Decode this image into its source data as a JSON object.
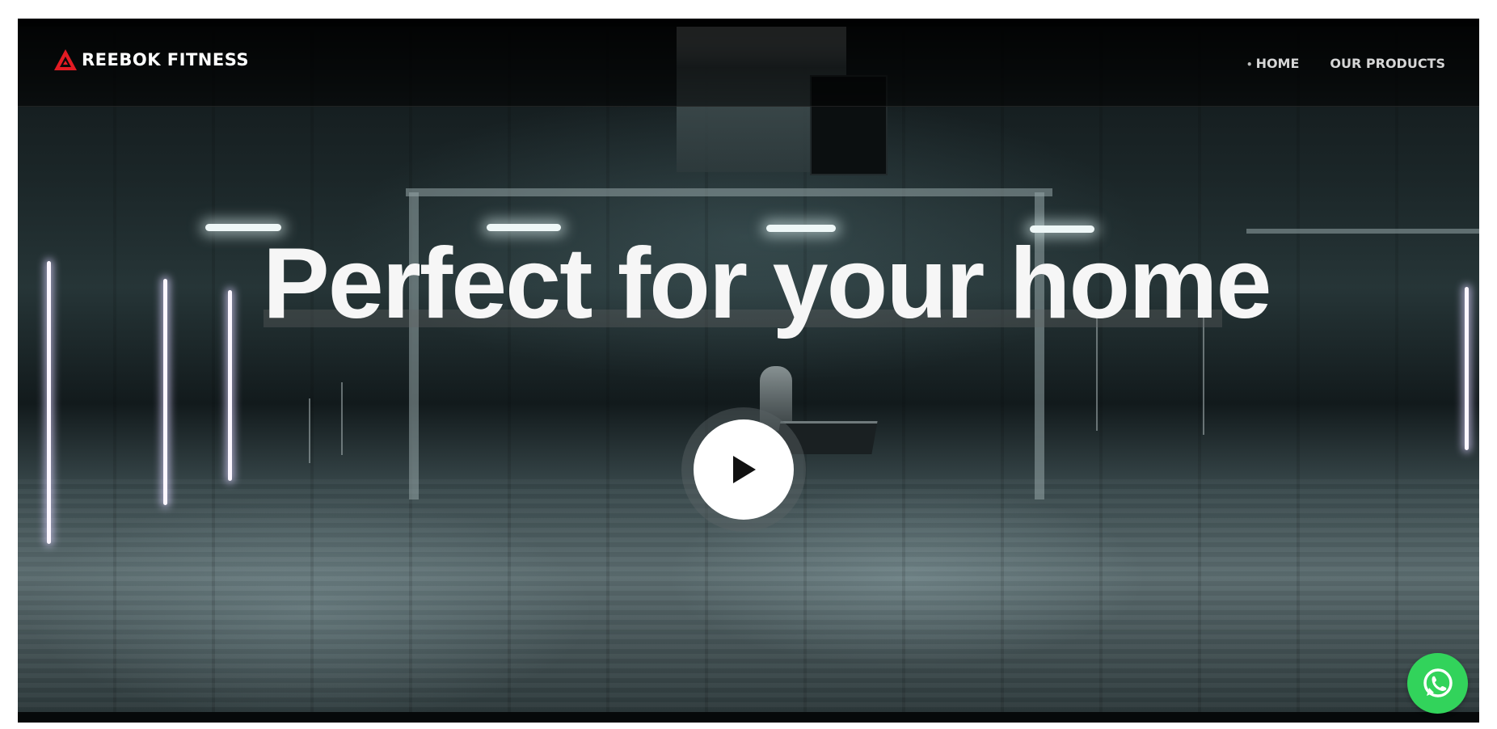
{
  "brand": {
    "name": "REEBOK FITNESS",
    "logo_icon": "reebok-delta-logo",
    "accent_color": "#e31b23"
  },
  "nav": {
    "items": [
      {
        "label": "HOME",
        "active": true
      },
      {
        "label": "OUR PRODUCTS",
        "active": false
      }
    ]
  },
  "hero": {
    "headline": "Perfect for your home",
    "play_icon": "play-icon"
  },
  "whatsapp": {
    "icon": "whatsapp-icon",
    "color": "#32d35b"
  }
}
